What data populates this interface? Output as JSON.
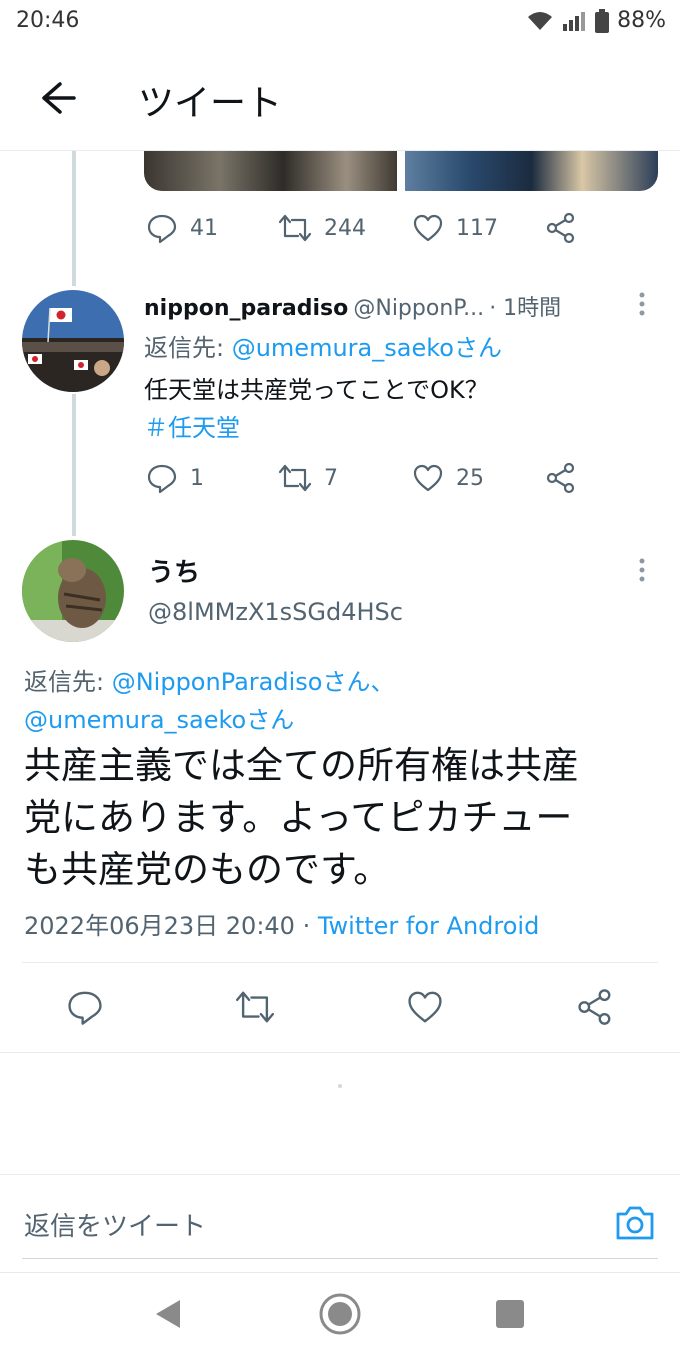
{
  "status_bar": {
    "time": "20:46",
    "battery": "88%"
  },
  "header": {
    "title": "ツイート"
  },
  "prev_tweet": {
    "reply_count": "41",
    "retweet_count": "244",
    "like_count": "117"
  },
  "reply_tweet": {
    "display_name": "nippon_paradiso",
    "handle": "@NipponP...",
    "time": "· 1時間",
    "reply_to_label": "返信先: ",
    "reply_to_user": "@umemura_saekoさん",
    "text": "任天堂は共産党ってことでOK？",
    "hashtag": "＃任天堂",
    "reply_count": "1",
    "retweet_count": "7",
    "like_count": "25"
  },
  "main_tweet": {
    "display_name": "うち",
    "handle": "@8lMMzX1sSGd4HSc",
    "reply_to_label": "返信先: ",
    "reply_to_user1": "@NipponParadisoさん、",
    "reply_to_user2": "@umemura_saekoさん",
    "text_line1": "共産主義では全ての所有権は共産",
    "text_line2": "党にあります。よってピカチュー",
    "text_line3": "も共産党のものです。",
    "timestamp": "2022年06月23日 20:40 · ",
    "source": "Twitter for Android"
  },
  "compose": {
    "placeholder": "返信をツイート"
  },
  "colors": {
    "accent": "#1d9bf0",
    "text_secondary": "#536471",
    "divider": "#e6ecf0"
  },
  "icons": [
    "arrow-left-icon",
    "reply-icon",
    "retweet-icon",
    "like-icon",
    "share-icon",
    "more-icon",
    "camera-icon",
    "wifi-icon",
    "signal-icon",
    "battery-icon",
    "nav-back-icon",
    "nav-home-icon",
    "nav-recents-icon"
  ]
}
